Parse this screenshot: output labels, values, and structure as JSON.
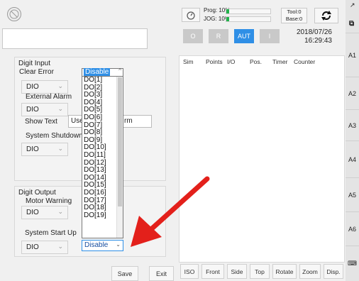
{
  "left": {
    "text_box_value": "",
    "digit_input": {
      "title": "Digit Input",
      "clear_error": {
        "label": "Clear Error",
        "type": "DIO",
        "value": "Disable"
      },
      "external_alarm": {
        "label": "External Alarm",
        "type": "DIO"
      },
      "show_text": {
        "label": "Show Text",
        "value_prefix": "Use",
        "value_suffix": "rm"
      },
      "system_shutdown": {
        "label": "System Shutdown",
        "type": "DIO"
      }
    },
    "digit_output": {
      "title": "Digit Output",
      "motor_warning": {
        "label": "Motor Warning",
        "type": "DIO"
      },
      "system_start_up": {
        "label": "System Start Up",
        "type": "DIO",
        "value": "Disable"
      }
    },
    "dropdown_options": [
      "DO[1]",
      "DO[2]",
      "DO[3]",
      "DO[4]",
      "DO[5]",
      "DO[6]",
      "DO[7]",
      "DO[8]",
      "DO[9]",
      "DO[10]",
      "DO[11]",
      "DO[12]",
      "DO[13]",
      "DO[14]",
      "DO[15]",
      "DO[16]",
      "DO[17]",
      "DO[18]",
      "DO[19]"
    ],
    "save_label": "Save",
    "exit_label": "Exit"
  },
  "top": {
    "prog": "Prog: 10%",
    "jog": "JOG: 10%",
    "tool": "Tool:0",
    "base": "Base:0",
    "date": "2018/07/26",
    "time": "16:29:43",
    "mode_buttons": [
      "O",
      "R",
      "AUT",
      "I"
    ]
  },
  "tabs": [
    "Sim",
    "Points",
    "I/O",
    "Pos.",
    "Timer",
    "Counter"
  ],
  "view_buttons": [
    "ISO",
    "Front",
    "Side",
    "Top",
    "Rotate",
    "Zoom",
    "Disp."
  ],
  "right_side": [
    "A1",
    "A2",
    "A3",
    "A4",
    "A5",
    "A6"
  ],
  "colors": {
    "accent": "#2f8fe6",
    "arrow": "#e3201b",
    "green": "#22b24c"
  }
}
